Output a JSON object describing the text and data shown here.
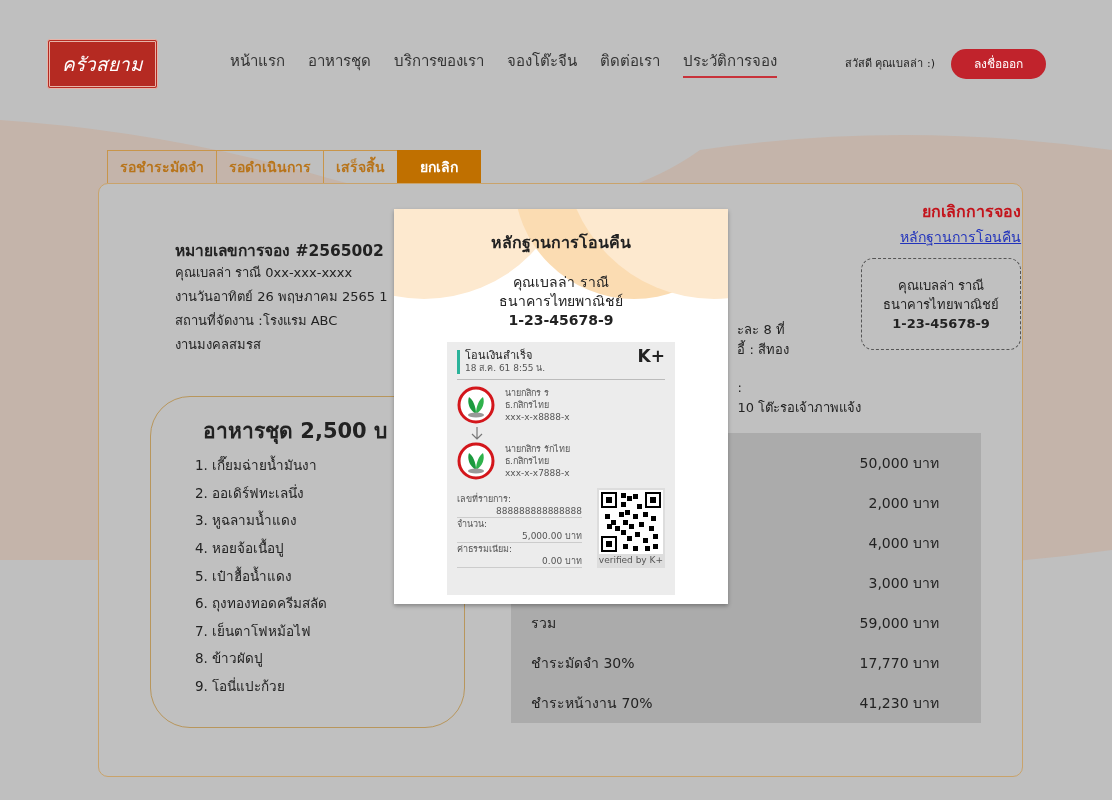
{
  "logo": {
    "text": "ครัวสยาม"
  },
  "nav": {
    "items": [
      {
        "label": "หน้าแรก",
        "selected": false
      },
      {
        "label": "อาหารชุด",
        "selected": false
      },
      {
        "label": "บริการของเรา",
        "selected": false
      },
      {
        "label": "จองโต๊ะจีน",
        "selected": false
      },
      {
        "label": "ติดต่อเรา",
        "selected": false
      },
      {
        "label": "ประวัติการจอง",
        "selected": true
      }
    ],
    "greeting": "สวัสดี คุณเบลล่า :)",
    "logout": "ลงชื่อออก"
  },
  "tabs": [
    {
      "label": "รอชำระมัดจำ",
      "selected": false
    },
    {
      "label": "รอดำเนินการ",
      "selected": false
    },
    {
      "label": "เสร็จสิ้น",
      "selected": false
    },
    {
      "label": "ยกเลิก",
      "selected": true
    }
  ],
  "booking": {
    "title": "หมายเลขการจอง #2565002",
    "lines": [
      "คุณเบลล่า ราณี 0xx-xxx-xxxx",
      "งานวันอาทิตย์ 26 พฤษภาคม 2565 1",
      "สถานที่จัดงาน :โรงแรม ABC",
      "งานมงคลสมรส"
    ]
  },
  "details": [
    "ะละ 8 ที่",
    "อี้ : สีทอง",
    ":",
    "10 โต๊ะรอเจ้าภาพแจ้ง"
  ],
  "status": {
    "title": "ยกเลิกการจอง",
    "link": "หลักฐานการโอนคืน",
    "refund_account": {
      "name": "คุณเบลล่า ราณี",
      "bank": "ธนาคารไทยพาณิชย์",
      "number": "1-23-45678-9"
    }
  },
  "menu": {
    "title": "อาหารชุด 2,500 บ",
    "items": [
      "1. เกี๊ยมฉ่ายน้ำมันงา",
      "2. ออเดิร์ฟทะเลนึ่ง",
      "3. หูฉลามน้ำแดง",
      "4. หอยจ้อเนื้อปู",
      "5. เป๋าฮื้อน้ำแดง",
      "6. ถุงทองทอดครีมสลัด",
      "7. เย็นตาโฟหม้อไฟ",
      "8. ข้าวผัดปู",
      "9. โอนี่แปะก้วย"
    ]
  },
  "prices": [
    {
      "value": "50,000 บาท"
    },
    {
      "value": "2,000 บาท"
    },
    {
      "value": "4,000 บาท"
    },
    {
      "value": "3,000 บาท"
    },
    {
      "label": "รวม",
      "value": "59,000 บาท"
    },
    {
      "label": "ชำระมัดจำ 30%",
      "value": "17,770 บาท"
    },
    {
      "label": "ชำระหน้างาน 70%",
      "value": "41,230 บาท"
    }
  ],
  "modal": {
    "title": "หลักฐานการโอนคืน",
    "name": "คุณเบลล่า ราณี",
    "bank": "ธนาคารไทยพาณิชย์",
    "number": "1-23-45678-9",
    "slip": {
      "heading": "โอนเงินสำเร็จ",
      "datetime": "18 ส.ค. 61  8:55 น.",
      "brand": "K+",
      "parties": [
        {
          "name": "นายกสิกร ร",
          "bank": "ธ.กสิกรไทย",
          "account": "xxx-x-x8888-x"
        },
        {
          "name": "นายกสิกร รักไทย",
          "bank": "ธ.กสิกรไทย",
          "account": "xxx-x-x7888-x"
        }
      ],
      "fields": [
        {
          "label": "เลขที่รายการ:",
          "value": "888888888888888"
        },
        {
          "label": "จำนวน:",
          "value": "5,000.00 บาท"
        },
        {
          "label": "ค่าธรรมเนียม:",
          "value": "0.00 บาท"
        }
      ],
      "verified": "verified by K+"
    }
  }
}
